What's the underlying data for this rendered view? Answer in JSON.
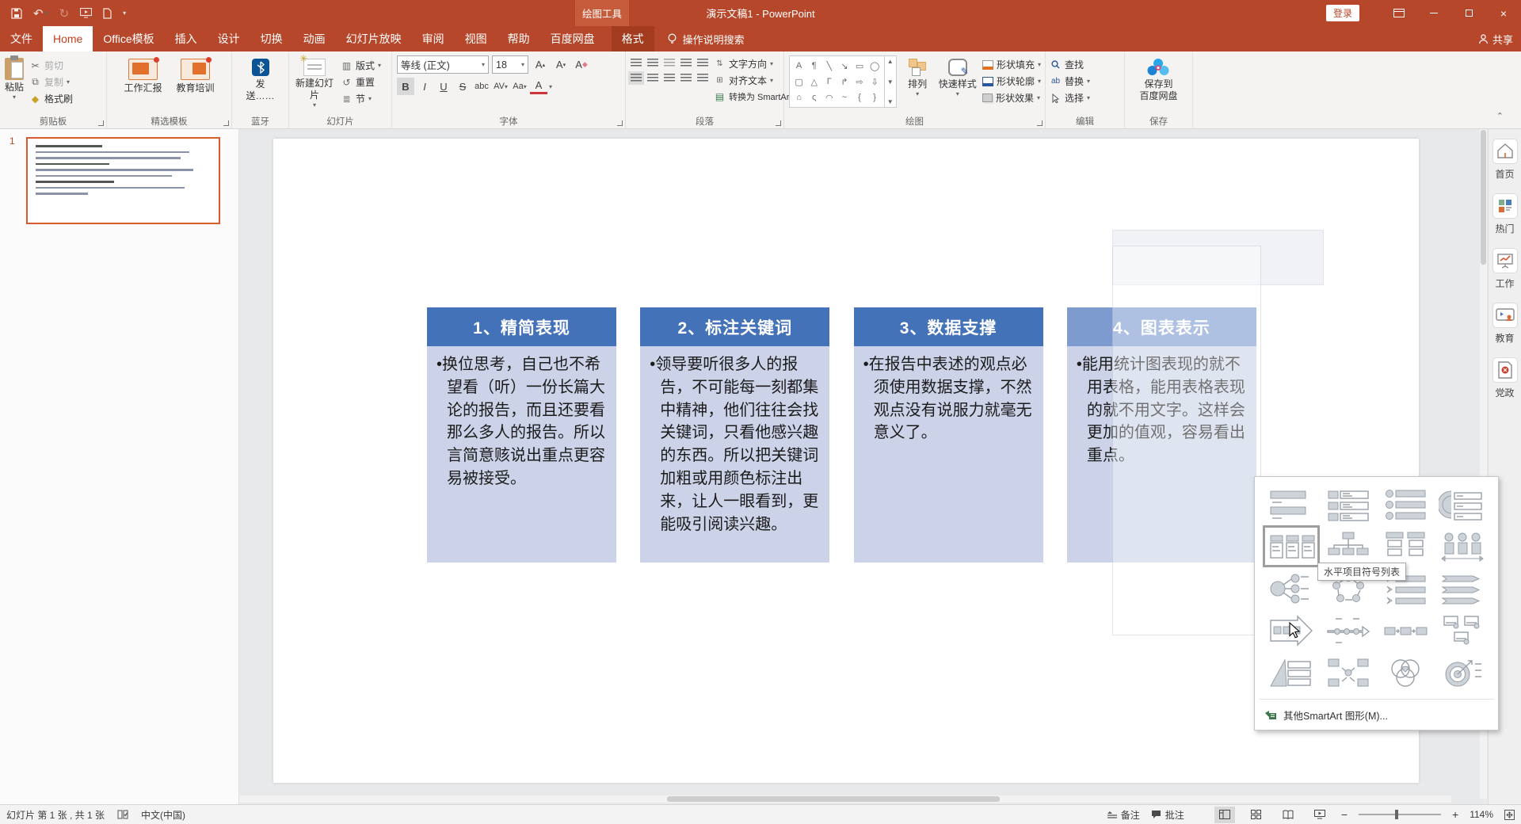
{
  "colors": {
    "accent_red": "#B7472A",
    "context_tab_bg": "#C75C3D",
    "box_header_blue": "#4472B9",
    "box_header_light": "#7E9BD0",
    "box_body": "#CCD3E8",
    "selected_thumb_border": "#DC5B2E"
  },
  "titlebar": {
    "title": "演示文稿1 - PowerPoint",
    "context_tool": "绘图工具",
    "login": "登录",
    "quick_access": [
      {
        "icon": "save-icon"
      },
      {
        "icon": "undo-icon"
      },
      {
        "icon": "redo-icon"
      },
      {
        "icon": "slideshow-icon"
      },
      {
        "icon": "new-doc-icon"
      },
      {
        "icon": "customize-qat-icon"
      }
    ]
  },
  "tabs": {
    "file": "文件",
    "active": "Home",
    "context_tab": "格式",
    "tell_me": "操作说明搜索",
    "share": "共享",
    "items": [
      "Home",
      "Office模板",
      "插入",
      "设计",
      "切换",
      "动画",
      "幻灯片放映",
      "审阅",
      "视图",
      "帮助",
      "百度网盘"
    ]
  },
  "ribbon": {
    "groups": {
      "clipboard": {
        "label": "剪贴板",
        "paste": "粘贴",
        "cut": "剪切",
        "copy": "复制",
        "format_painter": "格式刷"
      },
      "templates": {
        "label": "精选模板",
        "work_report": "工作汇报",
        "edu_training": "教育培训"
      },
      "bluetooth": {
        "label": "蓝牙",
        "send": "发送……"
      },
      "slides": {
        "label": "幻灯片",
        "new_slide": "新建幻灯片",
        "layout": "版式",
        "reset": "重置",
        "section": "节"
      },
      "font": {
        "label": "字体",
        "family": "等线 (正文)",
        "size": "18"
      },
      "paragraph": {
        "label": "段落",
        "text_direction": "文字方向",
        "align_text": "对齐文本",
        "to_smartart": "转换为 SmartArt"
      },
      "drawing": {
        "label": "绘图",
        "arrange": "排列",
        "quick_styles": "快速样式",
        "shape_fill": "形状填充",
        "shape_outline": "形状轮廓",
        "shape_effects": "形状效果"
      },
      "editing": {
        "label": "编辑",
        "find": "查找",
        "replace": "替换",
        "select": "选择"
      },
      "save": {
        "label": "保存",
        "baidu_line1": "保存到",
        "baidu_line2": "百度网盘"
      }
    }
  },
  "slide_panel": {
    "number": "1"
  },
  "slide": {
    "boxes": [
      {
        "title": "1、精简表现",
        "body": "换位思考，自己也不希望看（听）一份长篇大论的报告，而且还要看那么多人的报告。所以言简意赅说出重点更容易被接受。"
      },
      {
        "title": "2、标注关键词",
        "body": "领导要听很多人的报告，不可能每一刻都集中精神，他们往往会找关键词，只看他感兴趣的东西。所以把关键词加粗或用颜色标注出来，让人一眼看到，更能吸引阅读兴趣。"
      },
      {
        "title": "3、数据支撑",
        "body": "在报告中表述的观点必须使用数据支撑，不然观点没有说服力就毫无意义了。"
      },
      {
        "title": "4、图表表示",
        "body": "能用统计图表现的就不用表格，能用表格表现的就不用文字。这样会更加的值观，容易看出重点。"
      }
    ]
  },
  "sidebar": {
    "items": [
      {
        "label": "首页",
        "icon": "home-icon"
      },
      {
        "label": "热门",
        "icon": "hot-icon"
      },
      {
        "label": "工作",
        "icon": "work-icon"
      },
      {
        "label": "教育",
        "icon": "edu-icon"
      },
      {
        "label": "党政",
        "icon": "party-icon"
      }
    ]
  },
  "smartart_popup": {
    "tooltip": "水平项目符号列表",
    "more": "其他SmartArt 图形(M)...",
    "selected_index": 4,
    "items": [
      "stacked-list",
      "vertical-box-list",
      "vertical-bullet-list",
      "bending-list",
      "horizontal-bullet-list",
      "organization-chart",
      "grouped-list",
      "continuous-picture-list",
      "radial-cluster",
      "basic-cycle",
      "vertical-chevron-list",
      "arrow-ribbon-list",
      "basic-process-arrow",
      "circle-accent-timeline",
      "chain-process",
      "titled-picture-blocks",
      "pyramid-list",
      "converging-radial",
      "basic-venn",
      "nested-target"
    ]
  },
  "statusbar": {
    "slide_info": "幻灯片 第 1 张 , 共 1 张",
    "language": "中文(中国)",
    "notes": "备注",
    "comments": "批注",
    "zoom": "114%"
  }
}
